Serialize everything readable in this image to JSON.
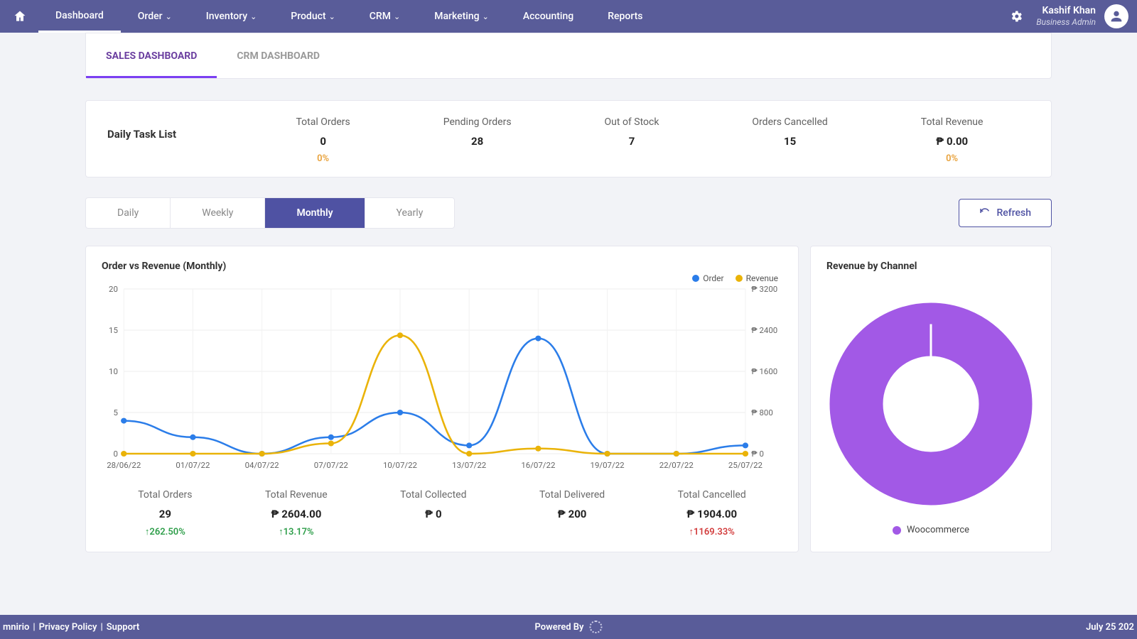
{
  "nav": {
    "items": [
      {
        "label": "Dashboard",
        "active": true,
        "dropdown": false
      },
      {
        "label": "Order",
        "dropdown": true
      },
      {
        "label": "Inventory",
        "dropdown": true
      },
      {
        "label": "Product",
        "dropdown": true
      },
      {
        "label": "CRM",
        "dropdown": true
      },
      {
        "label": "Marketing",
        "dropdown": true
      },
      {
        "label": "Accounting",
        "dropdown": false
      },
      {
        "label": "Reports",
        "dropdown": false
      }
    ],
    "user": {
      "name": "Kashif Khan",
      "role": "Business Admin"
    }
  },
  "tabs": [
    {
      "label": "SALES DASHBOARD",
      "active": true
    },
    {
      "label": "CRM DASHBOARD",
      "active": false
    }
  ],
  "taskList": {
    "title": "Daily Task List",
    "stats": [
      {
        "label": "Total Orders",
        "value": "0",
        "pct": "0%"
      },
      {
        "label": "Pending Orders",
        "value": "28"
      },
      {
        "label": "Out of Stock",
        "value": "7"
      },
      {
        "label": "Orders Cancelled",
        "value": "15"
      },
      {
        "label": "Total Revenue",
        "value": "₱  0.00",
        "pct": "0%"
      }
    ]
  },
  "period": {
    "tabs": [
      "Daily",
      "Weekly",
      "Monthly",
      "Yearly"
    ],
    "active": "Monthly",
    "refresh": "Refresh"
  },
  "chart_data": [
    {
      "type": "line",
      "title": "Order vs Revenue (Monthly)",
      "x": [
        "28/06/22",
        "01/07/22",
        "04/07/22",
        "07/07/22",
        "10/07/22",
        "13/07/22",
        "16/07/22",
        "19/07/22",
        "22/07/22",
        "25/07/22"
      ],
      "y_left_ticks": [
        0,
        5,
        10,
        15,
        20
      ],
      "y_right_ticks": [
        0,
        800,
        1600,
        2400,
        3200
      ],
      "y_right_prefix": "₱",
      "series": [
        {
          "name": "Order",
          "axis": "left",
          "color": "#2b7de9",
          "values": [
            4,
            2,
            0,
            2,
            5,
            1,
            14,
            0,
            0,
            1
          ]
        },
        {
          "name": "Revenue",
          "axis": "right",
          "color": "#eab308",
          "values": [
            0,
            0,
            0,
            200,
            2300,
            0,
            100,
            0,
            0,
            0
          ]
        }
      ]
    },
    {
      "type": "pie",
      "style": "donut",
      "title": "Revenue by Channel",
      "series": [
        {
          "name": "Woocommerce",
          "value": 100,
          "color": "#a259e6"
        }
      ]
    }
  ],
  "summary": [
    {
      "label": "Total Orders",
      "value": "29",
      "delta": "262.50%",
      "dir": "up"
    },
    {
      "label": "Total Revenue",
      "value": "₱  2604.00",
      "delta": "13.17%",
      "dir": "up"
    },
    {
      "label": "Total Collected",
      "value": "₱  0"
    },
    {
      "label": "Total Delivered",
      "value": "₱  200"
    },
    {
      "label": "Total Cancelled",
      "value": "₱  1904.00",
      "delta": "1169.33%",
      "dir": "down"
    }
  ],
  "donut": {
    "title": "Revenue by Channel",
    "legend": "Woocommerce"
  },
  "footer": {
    "left_prefix": "mnirio",
    "privacy": "Privacy Policy",
    "support": "Support",
    "powered": "Powered By",
    "date": "July 25 202"
  }
}
